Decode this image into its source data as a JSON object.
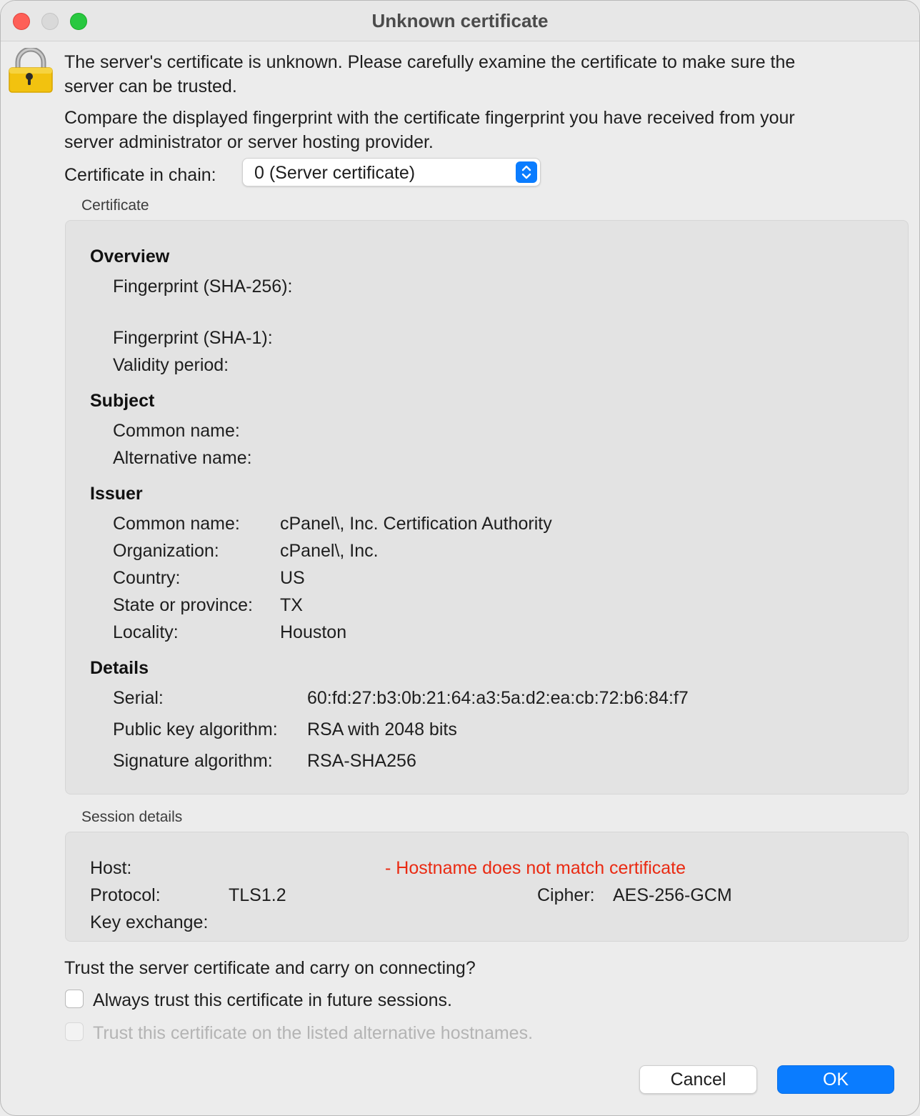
{
  "window": {
    "title": "Unknown certificate"
  },
  "intro": {
    "line1": "The server's certificate is unknown. Please carefully examine the certificate to make sure the",
    "line2": "server can be trusted.",
    "line3": "Compare the displayed fingerprint with the certificate fingerprint you have received from your",
    "line4": "server administrator or server hosting provider."
  },
  "chain": {
    "label": "Certificate in chain:",
    "selected": "0 (Server certificate)"
  },
  "certificate": {
    "group_label": "Certificate",
    "overview": {
      "heading": "Overview",
      "fingerprint_sha256_label": "Fingerprint (SHA-256):",
      "fingerprint_sha1_label": "Fingerprint (SHA-1):",
      "validity_label": "Validity period:"
    },
    "subject": {
      "heading": "Subject",
      "common_name_label": "Common name:",
      "alt_name_label": "Alternative name:"
    },
    "issuer": {
      "heading": "Issuer",
      "common_name_label": "Common name:",
      "common_name": "cPanel\\, Inc. Certification Authority",
      "organization_label": "Organization:",
      "organization": "cPanel\\, Inc.",
      "country_label": "Country:",
      "country": "US",
      "state_label": "State or province:",
      "state": "TX",
      "locality_label": "Locality:",
      "locality": "Houston"
    },
    "details": {
      "heading": "Details",
      "serial_label": "Serial:",
      "serial": "60:fd:27:b3:0b:21:64:a3:5a:d2:ea:cb:72:b6:84:f7",
      "pubkey_label": "Public key algorithm:",
      "pubkey": "RSA with 2048 bits",
      "sigalg_label": "Signature algorithm:",
      "sigalg": "RSA-SHA256"
    }
  },
  "session": {
    "group_label": "Session details",
    "host_label": "Host:",
    "host_warning": "- Hostname does not match certificate",
    "protocol_label": "Protocol:",
    "protocol": "TLS1.2",
    "cipher_label": "Cipher:",
    "cipher": "AES-256-GCM",
    "keyexchange_label": "Key exchange:"
  },
  "trust": {
    "question": "Trust the server certificate and carry on connecting?",
    "always_trust": "Always trust this certificate in future sessions.",
    "alt_hostnames": "Trust this certificate on the listed alternative hostnames."
  },
  "buttons": {
    "cancel": "Cancel",
    "ok": "OK"
  },
  "colors": {
    "accent": "#0a7cff",
    "warning": "#ea2a12",
    "lock": "#f2c20f"
  }
}
